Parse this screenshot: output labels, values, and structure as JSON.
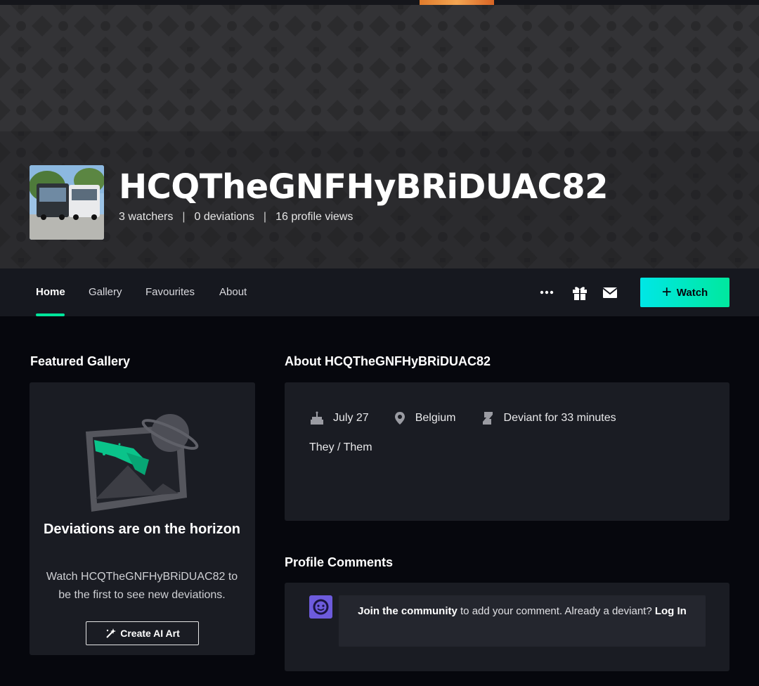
{
  "profile": {
    "username": "HCQTheGNFHyBRiDUAC82",
    "stats": {
      "watchers": "3 watchers",
      "deviations": "0 deviations",
      "views": "16 profile views",
      "separator": "|"
    }
  },
  "nav": {
    "tabs": [
      {
        "label": "Home",
        "active": true
      },
      {
        "label": "Gallery",
        "active": false
      },
      {
        "label": "Favourites",
        "active": false
      },
      {
        "label": "About",
        "active": false
      }
    ],
    "icons": [
      "more-icon",
      "gift-icon",
      "mail-icon"
    ],
    "watch_label": "Watch"
  },
  "featured": {
    "section_title": "Featured Gallery",
    "empty_title": "Deviations are on the horizon",
    "empty_desc": "Watch HCQTheGNFHyBRiDUAC82 to be the first to see new deviations.",
    "create_label": "Create AI Art"
  },
  "about": {
    "section_title": "About HCQTheGNFHyBRiDUAC82",
    "birthday": "July 27",
    "location": "Belgium",
    "deviant_since": "Deviant for 33 minutes",
    "pronouns": "They / Them"
  },
  "comments": {
    "section_title": "Profile Comments",
    "join_link": "Join the community",
    "join_text": " to add your comment. Already a deviant? ",
    "login_link": "Log In"
  },
  "colors": {
    "accent_green": "#00e59b",
    "accent_cyan": "#00e7e6",
    "background": "#06070d",
    "card": "#1a1c23"
  }
}
